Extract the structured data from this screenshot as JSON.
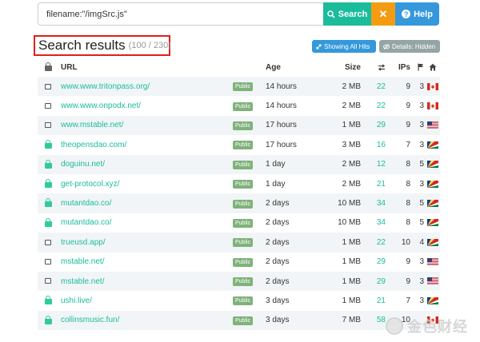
{
  "search": {
    "value": "filename:\"/imgSrc.js\"",
    "search_label": "Search",
    "clear_label": "✕",
    "help_label": "Help"
  },
  "heading": {
    "title": "Search results",
    "count": "(100 / 230)"
  },
  "pills": {
    "showing_all_hits": "Showing All Hits",
    "details_hidden": "Details: Hidden"
  },
  "table": {
    "columns": {
      "url": "URL",
      "age": "Age",
      "size": "Size",
      "ips": "IPs"
    },
    "rows": [
      {
        "lock": "open",
        "url": "www.www.tritonpass.org/",
        "badge": "Public",
        "age": "14 hours",
        "size": "2 MB",
        "hits": "22",
        "ips": "9",
        "flags": "3",
        "country": "CA"
      },
      {
        "lock": "open",
        "url": "www.www.onpodx.net/",
        "badge": "Public",
        "age": "14 hours",
        "size": "2 MB",
        "hits": "22",
        "ips": "9",
        "flags": "3",
        "country": "CA"
      },
      {
        "lock": "open",
        "url": "www.mstable.net/",
        "badge": "Public",
        "age": "17 hours",
        "size": "1 MB",
        "hits": "29",
        "ips": "9",
        "flags": "3",
        "country": "US"
      },
      {
        "lock": "closed",
        "url": "theopensdao.com/",
        "badge": "Public",
        "age": "17 hours",
        "size": "3 MB",
        "hits": "16",
        "ips": "7",
        "flags": "3",
        "country": "SC"
      },
      {
        "lock": "closed",
        "url": "doguinu.net/",
        "badge": "Public",
        "age": "1 day",
        "size": "2 MB",
        "hits": "12",
        "ips": "8",
        "flags": "5",
        "country": "SC"
      },
      {
        "lock": "closed",
        "url": "get-protocol.xyz/",
        "badge": "Public",
        "age": "1 day",
        "size": "2 MB",
        "hits": "21",
        "ips": "8",
        "flags": "3",
        "country": "SC"
      },
      {
        "lock": "closed",
        "url": "mutantdao.co/",
        "badge": "Public",
        "age": "2 days",
        "size": "10 MB",
        "hits": "34",
        "ips": "8",
        "flags": "5",
        "country": "SC"
      },
      {
        "lock": "closed",
        "url": "mutantdao.co/",
        "badge": "Public",
        "age": "2 days",
        "size": "10 MB",
        "hits": "34",
        "ips": "8",
        "flags": "5",
        "country": "SC"
      },
      {
        "lock": "open",
        "url": "trueusd.app/",
        "badge": "Public",
        "age": "2 days",
        "size": "1 MB",
        "hits": "22",
        "ips": "10",
        "flags": "4",
        "country": "SC"
      },
      {
        "lock": "open",
        "url": "mstable.net/",
        "badge": "Public",
        "age": "2 days",
        "size": "1 MB",
        "hits": "29",
        "ips": "9",
        "flags": "3",
        "country": "US"
      },
      {
        "lock": "open",
        "url": "mstable.net/",
        "badge": "Public",
        "age": "2 days",
        "size": "1 MB",
        "hits": "29",
        "ips": "9",
        "flags": "3",
        "country": "US"
      },
      {
        "lock": "closed",
        "url": "ushi.live/",
        "badge": "Public",
        "age": "3 days",
        "size": "1 MB",
        "hits": "21",
        "ips": "7",
        "flags": "3",
        "country": "SC"
      },
      {
        "lock": "closed",
        "url": "collinsmusic.fun/",
        "badge": "Public",
        "age": "3 days",
        "size": "7 MB",
        "hits": "58",
        "ips": "10",
        "flags": "",
        "country": "CA"
      }
    ]
  },
  "watermark": {
    "text": "金色财经"
  },
  "colors": {
    "accent": "#1abc9c",
    "search_button": "#1abc9c",
    "clear_button": "#f39c12",
    "help_button": "#3498db",
    "badge": "#7fb27a",
    "highlight_border": "#e0201b"
  }
}
